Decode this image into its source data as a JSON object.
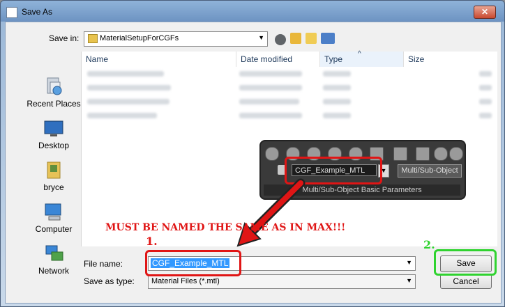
{
  "window": {
    "title": "Save As",
    "close_glyph": "✕"
  },
  "toolbar": {
    "save_in_label": "Save in:",
    "save_in_value": "MaterialSetupForCGFs",
    "icons": [
      "back-icon",
      "up-folder-icon",
      "new-folder-icon",
      "views-menu-icon"
    ]
  },
  "places": [
    {
      "label": "Recent Places",
      "icon": "recent-places-icon"
    },
    {
      "label": "Desktop",
      "icon": "desktop-icon"
    },
    {
      "label": "bryce",
      "icon": "user-folder-icon"
    },
    {
      "label": "Computer",
      "icon": "computer-icon"
    },
    {
      "label": "Network",
      "icon": "network-icon"
    }
  ],
  "file_list": {
    "columns": [
      "Name",
      "Date modified",
      "Type",
      "Size"
    ],
    "sort_indicator": "^"
  },
  "max_panel": {
    "material_name": "CGF_Example_MTL",
    "material_type": "Multi/Sub-Object",
    "rollout_title": "Multi/Sub-Object Basic Parameters"
  },
  "annotation": {
    "warning": "MUST BE NAMED THE SAME AS IN MAX!!!",
    "step1": "1.",
    "step2": "2.",
    "colors": {
      "red": "#e01515",
      "green": "#2fd32f"
    }
  },
  "form": {
    "file_name_label": "File name:",
    "file_name_value": "CGF_Example_MTL",
    "save_type_label": "Save as type:",
    "save_type_value": "Material Files (*.mtl)",
    "save_label": "Save",
    "cancel_label": "Cancel"
  }
}
